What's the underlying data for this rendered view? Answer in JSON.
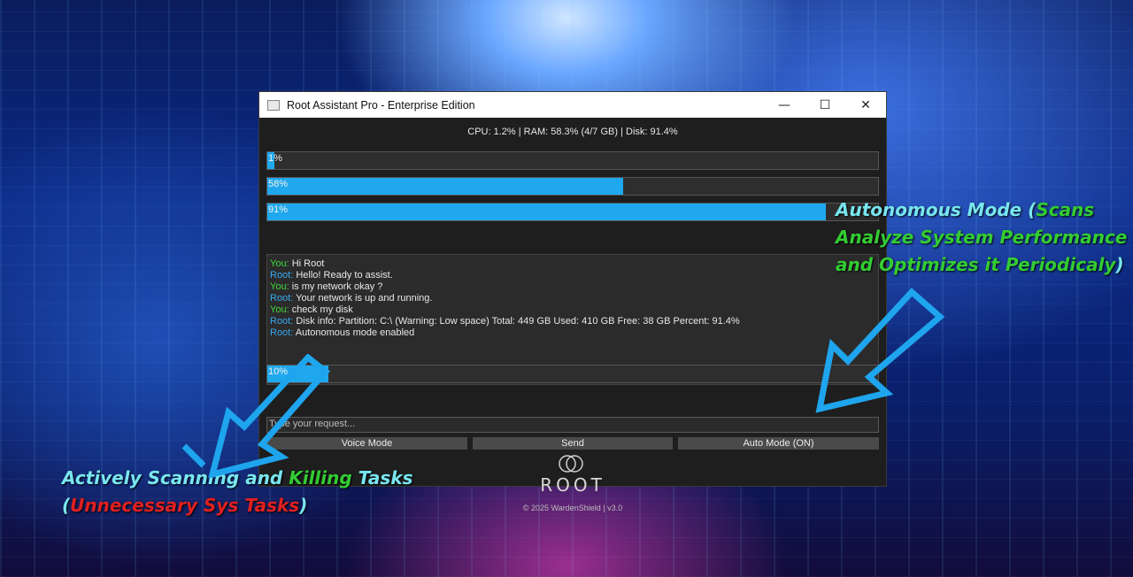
{
  "window": {
    "title": "Root Assistant Pro - Enterprise Edition",
    "minimize": "—",
    "maximize": "☐",
    "close": "✕"
  },
  "stats": "CPU: 1.2% | RAM: 58.3% (4/7 GB) | Disk: 91.4%",
  "bars": {
    "cpu": {
      "label": "1%",
      "value": 1.2
    },
    "ram": {
      "label": "58%",
      "value": 58.3
    },
    "disk": {
      "label": "91%",
      "value": 91.4
    },
    "task": {
      "label": "10%",
      "value": 10
    }
  },
  "chat": [
    {
      "speaker": "You:",
      "text": "Hi Root"
    },
    {
      "speaker": "Root:",
      "text": "Hello! Ready to assist."
    },
    {
      "speaker": "You:",
      "text": "is my network okay ?"
    },
    {
      "speaker": "Root:",
      "text": "Your network is up and running."
    },
    {
      "speaker": "You:",
      "text": "check my disk"
    },
    {
      "speaker": "Root:",
      "text": "Disk info: Partition: C:\\ (Warning: Low space) Total: 449 GB Used: 410 GB Free: 38 GB Percent: 91.4%"
    },
    {
      "speaker": "Root:",
      "text": "Autonomous mode enabled"
    }
  ],
  "input": {
    "placeholder": "Type your request..."
  },
  "buttons": {
    "voice": "Voice Mode",
    "send": "Send",
    "auto": "Auto Mode (ON)"
  },
  "logo": "ROOT",
  "footer": "© 2025 WardenShield | v3.0",
  "annotations": {
    "right": {
      "l1a": "Autonomous Mode (",
      "l1b": "Scans",
      "l2": "Analyze System Performance",
      "l3": "and Optimizes it Periodicaly",
      "l3end": ")"
    },
    "left": {
      "l1a": "Actively Scanning and ",
      "l1b": "Killing",
      "l1c": " Tasks",
      "l2a": "(",
      "l2b": "Unnecessary Sys Tasks",
      "l2c": ")"
    }
  },
  "colors": {
    "accent": "#1fa8ee",
    "you": "#3fd93f",
    "root": "#37a8f0"
  }
}
